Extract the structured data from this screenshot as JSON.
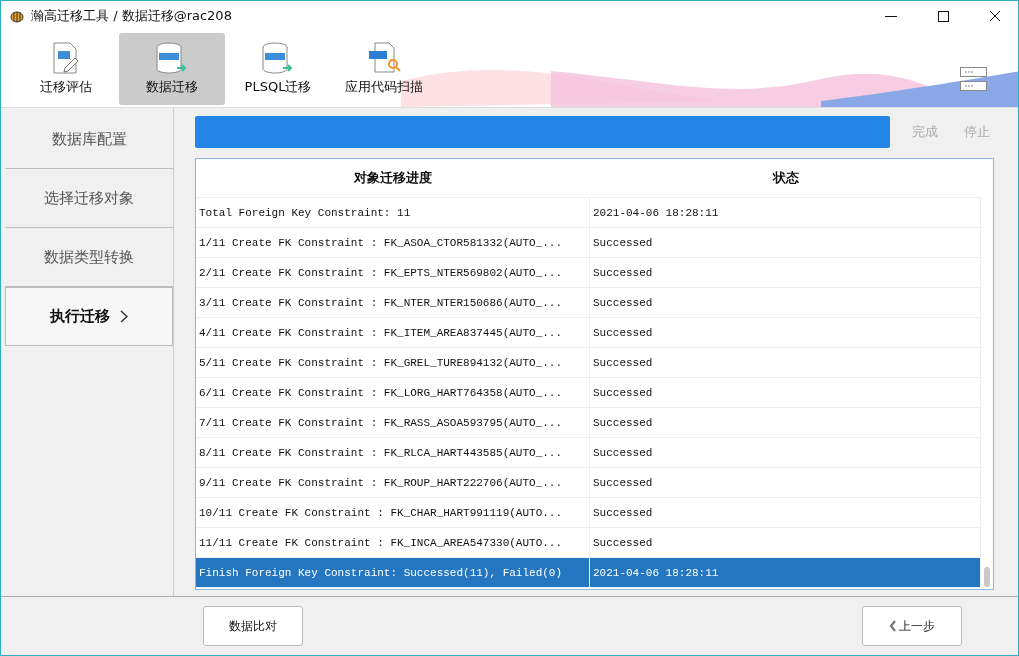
{
  "window": {
    "title": "瀚高迁移工具 / 数据迁移@rac208"
  },
  "toolbar": [
    {
      "label": "迁移评估",
      "kind": "pg",
      "selected": false
    },
    {
      "label": "数据迁移",
      "kind": "data",
      "selected": true
    },
    {
      "label": "PLSQL迁移",
      "kind": "sql",
      "selected": false
    },
    {
      "label": "应用代码扫描",
      "kind": "code",
      "selected": false
    }
  ],
  "sidebar": {
    "items": [
      {
        "label": "数据库配置",
        "selected": false
      },
      {
        "label": "选择迁移对象",
        "selected": false
      },
      {
        "label": "数据类型转换",
        "selected": false
      },
      {
        "label": "执行迁移",
        "selected": true
      }
    ]
  },
  "progress": {
    "level": 1
  },
  "actions": [
    {
      "label": "完成",
      "disabled": true
    },
    {
      "label": "停止",
      "disabled": true
    }
  ],
  "table": {
    "columns": [
      "对象迁移进度",
      "状态"
    ],
    "rows": [
      {
        "cells": [
          "Total Foreign Key Constraint: 11",
          "2021-04-06 18:28:11"
        ],
        "selected": false
      },
      {
        "cells": [
          "1/11 Create FK Constraint : FK_ASOA_CTOR581332(AUTO_...",
          "Successed"
        ],
        "selected": false
      },
      {
        "cells": [
          "2/11 Create FK Constraint : FK_EPTS_NTER569802(AUTO_...",
          "Successed"
        ],
        "selected": false
      },
      {
        "cells": [
          "3/11 Create FK Constraint : FK_NTER_NTER150686(AUTO_...",
          "Successed"
        ],
        "selected": false
      },
      {
        "cells": [
          "4/11 Create FK Constraint : FK_ITEM_AREA837445(AUTO_...",
          "Successed"
        ],
        "selected": false
      },
      {
        "cells": [
          "5/11 Create FK Constraint : FK_GREL_TURE894132(AUTO_...",
          "Successed"
        ],
        "selected": false
      },
      {
        "cells": [
          "6/11 Create FK Constraint : FK_LORG_HART764358(AUTO_...",
          "Successed"
        ],
        "selected": false
      },
      {
        "cells": [
          "7/11 Create FK Constraint : FK_RASS_ASOA593795(AUTO_...",
          "Successed"
        ],
        "selected": false
      },
      {
        "cells": [
          "8/11 Create FK Constraint : FK_RLCA_HART443585(AUTO_...",
          "Successed"
        ],
        "selected": false
      },
      {
        "cells": [
          "9/11 Create FK Constraint : FK_ROUP_HART222706(AUTO_...",
          "Successed"
        ],
        "selected": false
      },
      {
        "cells": [
          "10/11 Create FK Constraint : FK_CHAR_HART991119(AUTO...",
          "Successed"
        ],
        "selected": false
      },
      {
        "cells": [
          "11/11 Create FK Constraint : FK_INCA_AREA547330(AUTO...",
          "Successed"
        ],
        "selected": false
      },
      {
        "cells": [
          "Finish Foreign Key Constraint: Successed(11), Failed(0)",
          "2021-04-06 18:28:11"
        ],
        "selected": true
      }
    ]
  },
  "footer": {
    "left_button": "数据比对",
    "right_button": "上一步"
  }
}
